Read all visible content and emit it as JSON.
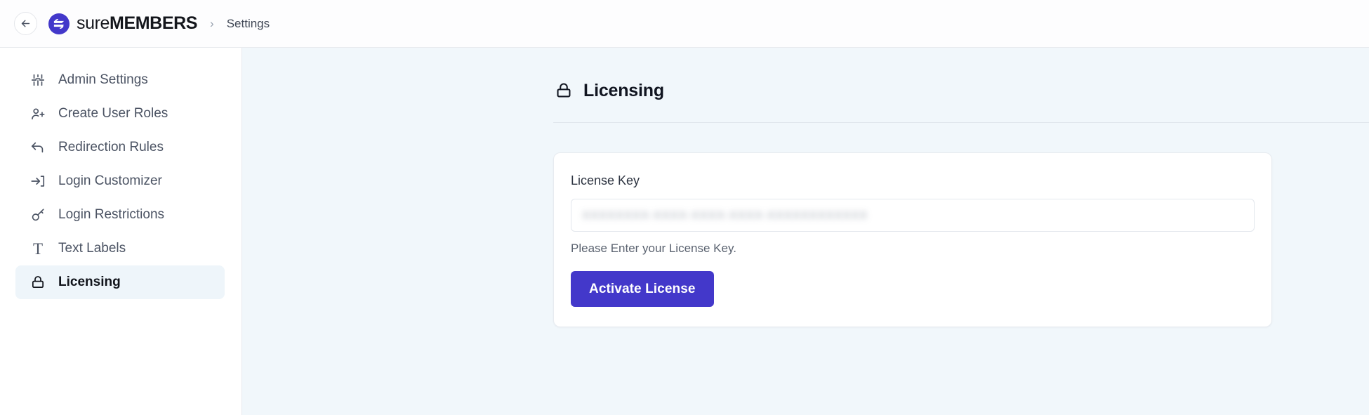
{
  "header": {
    "back_icon": "arrow-left-icon",
    "logo_icon": "suremembers-logo-icon",
    "brand_light": "sure",
    "brand_bold": "MEMBERS",
    "breadcrumb_separator": "›",
    "breadcrumb_current": "Settings"
  },
  "sidebar": {
    "items": [
      {
        "label": "Admin Settings",
        "icon": "sliders-icon",
        "active": false
      },
      {
        "label": "Create User Roles",
        "icon": "user-plus-icon",
        "active": false
      },
      {
        "label": "Redirection Rules",
        "icon": "arrow-return-icon",
        "active": false
      },
      {
        "label": "Login Customizer",
        "icon": "sign-in-icon",
        "active": false
      },
      {
        "label": "Login Restrictions",
        "icon": "key-icon",
        "active": false
      },
      {
        "label": "Text Labels",
        "icon": "text-format-icon",
        "active": false
      },
      {
        "label": "Licensing",
        "icon": "lock-icon",
        "active": true
      }
    ]
  },
  "main": {
    "title": "Licensing",
    "title_icon": "lock-icon",
    "card": {
      "field_label": "License Key",
      "license_key_value": "XXXXXXXX-XXXX-XXXX-XXXX-XXXXXXXXXXXX",
      "license_key_placeholder": "",
      "help_text": "Please Enter your License Key.",
      "activate_button": "Activate License"
    }
  },
  "colors": {
    "accent": "#4338ca",
    "active_nav_bg": "#eef5fa",
    "main_bg": "#f1f7fb",
    "sidebar_bg": "#ffffff"
  }
}
